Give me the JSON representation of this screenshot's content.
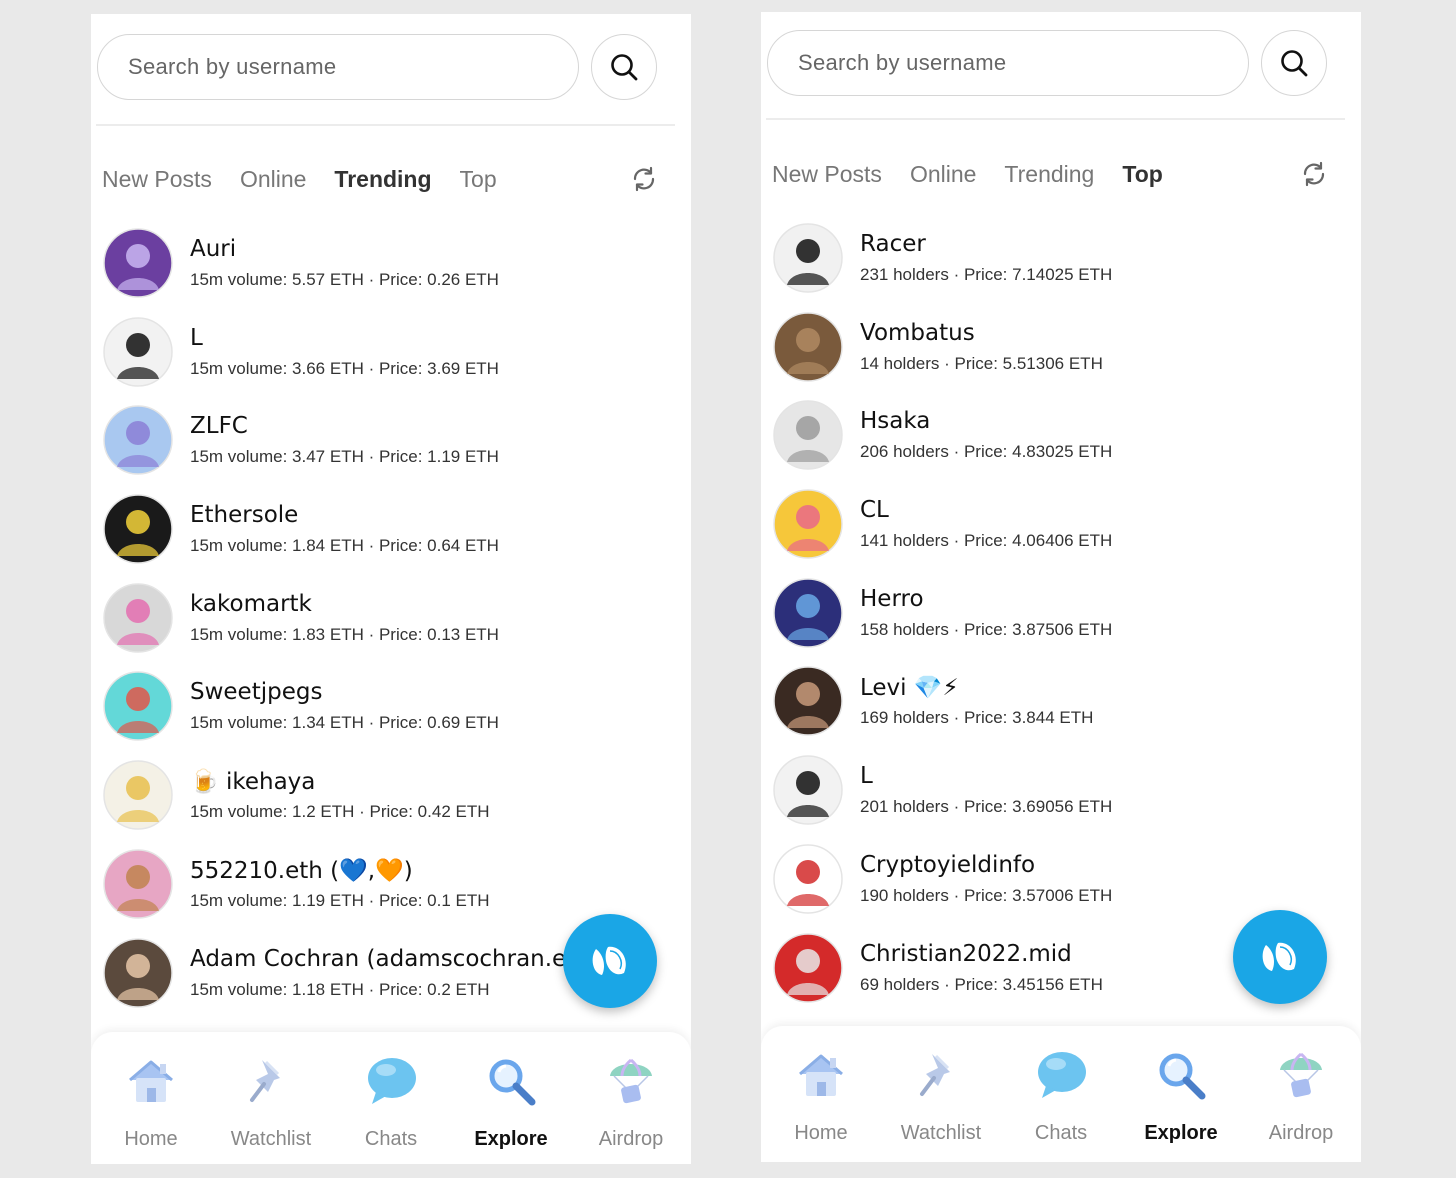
{
  "screens": [
    {
      "search_placeholder": "Search by username",
      "tabs": [
        {
          "label": "New Posts",
          "active": false
        },
        {
          "label": "Online",
          "active": false
        },
        {
          "label": "Trending",
          "active": true
        },
        {
          "label": "Top",
          "active": false
        }
      ],
      "items": [
        {
          "name": "Auri",
          "stats": "15m volume: 5.57 ETH · Price: 0.26 ETH",
          "avatar_color": "#6b3fa0",
          "avatar_accent": "#c9b6f2"
        },
        {
          "name": "L",
          "stats": "15m volume: 3.66 ETH · Price: 3.69 ETH",
          "avatar_color": "#f2f2f2",
          "avatar_accent": "#111111"
        },
        {
          "name": "ZLFC",
          "stats": "15m volume: 3.47 ETH · Price: 1.19 ETH",
          "avatar_color": "#a9c8f0",
          "avatar_accent": "#8b7fd6"
        },
        {
          "name": "Ethersole",
          "stats": "15m volume: 1.84 ETH · Price: 0.64 ETH",
          "avatar_color": "#1a1a1a",
          "avatar_accent": "#f5d33b"
        },
        {
          "name": "kakomartk",
          "stats": "15m volume: 1.83 ETH · Price: 0.13 ETH",
          "avatar_color": "#d8d8d8",
          "avatar_accent": "#e46fb0"
        },
        {
          "name": "Sweetjpegs",
          "stats": "15m volume: 1.34 ETH · Price: 0.69 ETH",
          "avatar_color": "#63d8d8",
          "avatar_accent": "#e0574a"
        },
        {
          "name": "🍺 ikehaya",
          "stats": "15m volume: 1.2 ETH · Price: 0.42 ETH",
          "avatar_color": "#f4f1e6",
          "avatar_accent": "#e8c04c"
        },
        {
          "name": "552210.eth (💙,🧡)",
          "stats": "15m volume: 1.19 ETH · Price: 0.1 ETH",
          "avatar_color": "#e7a6c4",
          "avatar_accent": "#c0834f"
        },
        {
          "name": "Adam Cochran (adamscochran.eth)",
          "stats": "15m volume: 1.18 ETH · Price: 0.2 ETH",
          "avatar_color": "#5b4a3d",
          "avatar_accent": "#e8c7a8"
        }
      ],
      "nav": [
        {
          "label": "Home",
          "icon": "home-icon",
          "active": false
        },
        {
          "label": "Watchlist",
          "icon": "pin-icon",
          "active": false
        },
        {
          "label": "Chats",
          "icon": "chat-bubble-icon",
          "active": false
        },
        {
          "label": "Explore",
          "icon": "magnifier-icon",
          "active": true
        },
        {
          "label": "Airdrop",
          "icon": "parachute-icon",
          "active": false
        }
      ]
    },
    {
      "search_placeholder": "Search by username",
      "tabs": [
        {
          "label": "New Posts",
          "active": false
        },
        {
          "label": "Online",
          "active": false
        },
        {
          "label": "Trending",
          "active": false
        },
        {
          "label": "Top",
          "active": true
        }
      ],
      "items": [
        {
          "name": "Racer",
          "stats": "231 holders · Price: 7.14025 ETH",
          "avatar_color": "#f1f1f1",
          "avatar_accent": "#111111"
        },
        {
          "name": "Vombatus",
          "stats": "14 holders · Price: 5.51306 ETH",
          "avatar_color": "#7a5a3c",
          "avatar_accent": "#b08a62"
        },
        {
          "name": "Hsaka",
          "stats": "206 holders · Price: 4.83025 ETH",
          "avatar_color": "#e6e6e6",
          "avatar_accent": "#9a9a9a"
        },
        {
          "name": "CL",
          "stats": "141 holders · Price: 4.06406 ETH",
          "avatar_color": "#f6c73a",
          "avatar_accent": "#e9688a"
        },
        {
          "name": "Herro",
          "stats": "158 holders · Price: 3.87506 ETH",
          "avatar_color": "#2c2f7a",
          "avatar_accent": "#6aa8e6"
        },
        {
          "name": "Levi 💎⚡",
          "stats": "169 holders · Price: 3.844 ETH",
          "avatar_color": "#3a2a22",
          "avatar_accent": "#c89a7a"
        },
        {
          "name": "L",
          "stats": "201 holders · Price: 3.69056 ETH",
          "avatar_color": "#f2f2f2",
          "avatar_accent": "#111111"
        },
        {
          "name": "Cryptoyieldinfo",
          "stats": "190 holders · Price: 3.57006 ETH",
          "avatar_color": "#ffffff",
          "avatar_accent": "#d22a2a"
        },
        {
          "name": "Christian2022.mid",
          "stats": "69 holders · Price: 3.45156 ETH",
          "avatar_color": "#d42a2a",
          "avatar_accent": "#e8e8e8"
        }
      ],
      "nav": [
        {
          "label": "Home",
          "icon": "home-icon",
          "active": false
        },
        {
          "label": "Watchlist",
          "icon": "pin-icon",
          "active": false
        },
        {
          "label": "Chats",
          "icon": "chat-bubble-icon",
          "active": false
        },
        {
          "label": "Explore",
          "icon": "magnifier-icon",
          "active": true
        },
        {
          "label": "Airdrop",
          "icon": "parachute-icon",
          "active": false
        }
      ]
    }
  ],
  "colors": {
    "fab": "#1aa6e6",
    "active_text": "#111111",
    "inactive_text": "#888888"
  }
}
